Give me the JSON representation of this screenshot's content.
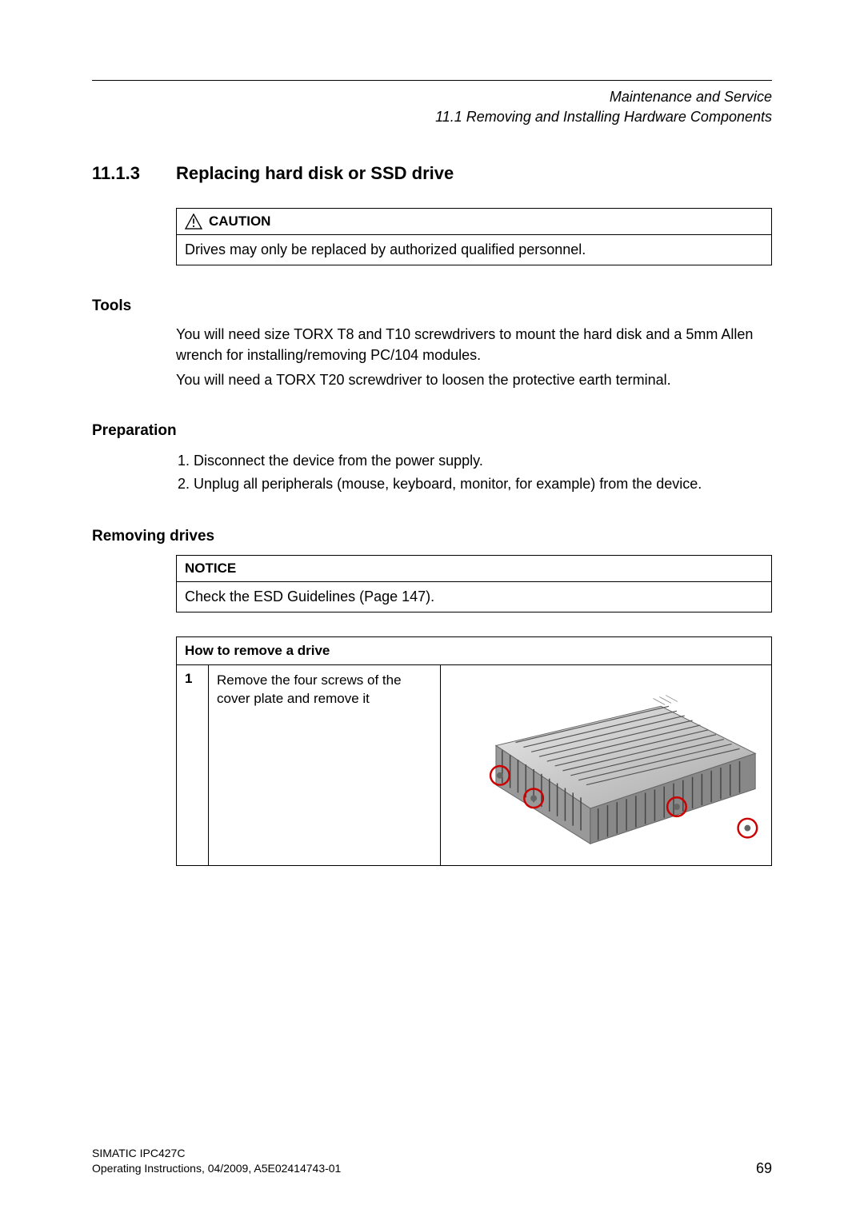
{
  "header": {
    "chapter": "Maintenance and Service",
    "section": "11.1 Removing and Installing Hardware Components"
  },
  "section": {
    "number": "11.1.3",
    "title": "Replacing hard disk or SSD drive"
  },
  "caution": {
    "label": "CAUTION",
    "text": "Drives may only be replaced by authorized qualified personnel."
  },
  "tools": {
    "heading": "Tools",
    "line1": "You will need size TORX T8 and T10 screwdrivers to mount the hard disk and a 5mm Allen wrench for installing/removing PC/104 modules.",
    "line2": "You will need a TORX T20 screwdriver to loosen the protective earth terminal."
  },
  "preparation": {
    "heading": "Preparation",
    "item1": "Disconnect the device from the power supply.",
    "item2": "Unplug all peripherals (mouse, keyboard, monitor, for example) from the device."
  },
  "removing": {
    "heading": "Removing drives"
  },
  "notice": {
    "label": "NOTICE",
    "text": "Check the ESD Guidelines (Page 147)."
  },
  "table": {
    "header": "How to remove a drive",
    "row1": {
      "num": "1",
      "desc": "Remove the four screws of the cover plate and remove it"
    }
  },
  "footer": {
    "product": "SIMATIC IPC427C",
    "docinfo": "Operating Instructions, 04/2009, A5E02414743-01",
    "page": "69"
  }
}
